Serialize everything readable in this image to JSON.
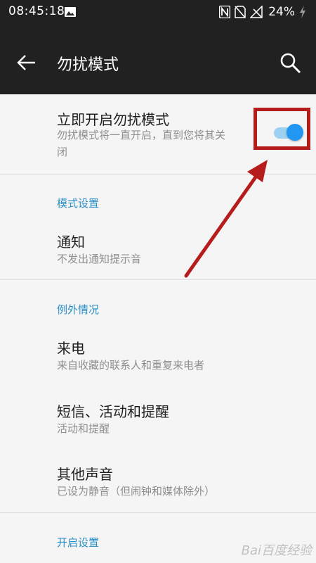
{
  "status_bar": {
    "time": "08:45:18",
    "battery": "24%",
    "icons": [
      "gallery-icon",
      "nfc-icon",
      "no-sim-icon",
      "no-signal-icon",
      "charging-icon"
    ]
  },
  "app_bar": {
    "title": "勿扰模式",
    "back_icon": "back-arrow-icon",
    "search_icon": "search-icon"
  },
  "settings": {
    "main_toggle": {
      "title": "立即开启勿扰模式",
      "subtitle_line1": "勿扰模式将一直开启，直到您将其关",
      "subtitle_line2": "闭",
      "state": "on"
    },
    "section_mode": "模式设置",
    "notification": {
      "title": "通知",
      "subtitle": "不发出通知提示音"
    },
    "section_exceptions": "例外情况",
    "calls": {
      "title": "来电",
      "subtitle": "来自收藏的联系人和重复来电者"
    },
    "messages": {
      "title": "短信、活动和提醒",
      "subtitle": "活动和提醒"
    },
    "other_sounds": {
      "title": "其他声音",
      "subtitle": "已设为静音（但闹钟和媒体除外）"
    },
    "section_start": "开启设置"
  },
  "annotation": {
    "box_color": "#b71c1c",
    "arrow_color": "#b71c1c"
  },
  "colors": {
    "accent": "#2a8fc5",
    "toggle_on": "#2196f3",
    "header_bg": "#212121",
    "page_bg": "#f5f5f5"
  },
  "watermark": "Bai百度经验"
}
